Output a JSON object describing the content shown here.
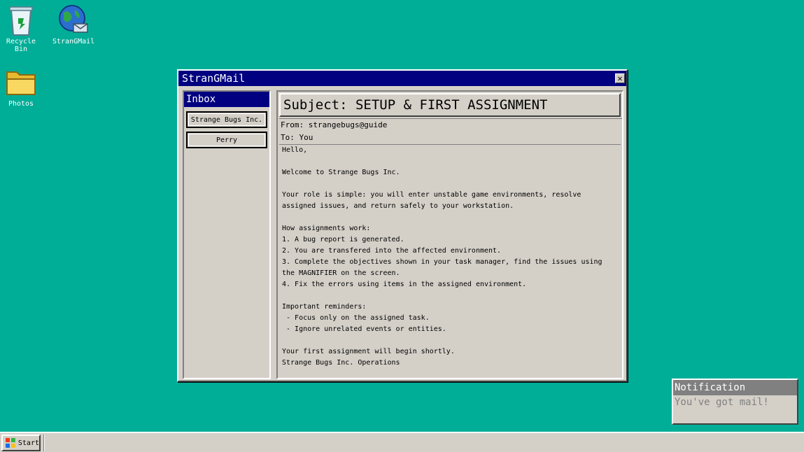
{
  "desktop": {
    "icons": [
      {
        "label": "Recycle Bin",
        "icon": "recycle-bin-icon"
      },
      {
        "label": "StranGMail",
        "icon": "globe-mail-icon"
      },
      {
        "label": "Photos",
        "icon": "folder-icon"
      }
    ]
  },
  "window": {
    "title": "StranGMail",
    "close_label": "✕",
    "sidebar": {
      "header": "Inbox",
      "items": [
        "Strange Bugs Inc.",
        "Perry"
      ]
    },
    "message": {
      "subject": "Subject: SETUP & FIRST ASSIGNMENT",
      "from": "From: strangebugs@guide",
      "to": "To: You",
      "body": "Hello,\n\nWelcome to Strange Bugs Inc.\n\nYour role is simple: you will enter unstable game environments, resolve\nassigned issues, and return safely to your workstation.\n\nHow assignments work:\n1. A bug report is generated.\n2. You are transfered into the affected environment.\n3. Complete the objectives shown in your task manager, find the issues using\nthe MAGNIFIER on the screen.\n4. Fix the errors using items in the assigned environment.\n\nImportant reminders:\n - Focus only on the assigned task.\n - Ignore unrelated events or entities.\n\nYour first assignment will begin shortly.\nStrange Bugs Inc. Operations"
    }
  },
  "notification": {
    "title": "Notification",
    "message": "You've got mail!"
  },
  "taskbar": {
    "start_label": "Start"
  },
  "colors": {
    "desktop": "#00ae98",
    "titlebar": "#000080",
    "chrome": "#d4d0c8"
  }
}
